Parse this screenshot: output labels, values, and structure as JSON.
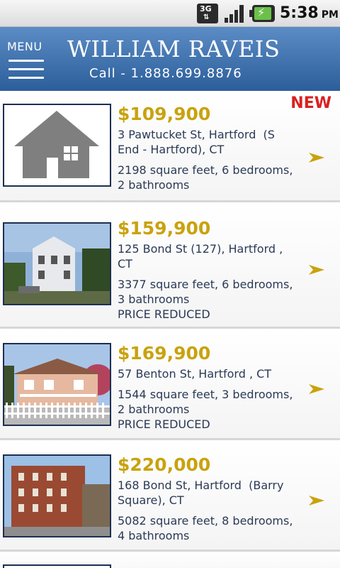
{
  "status_bar": {
    "network": "3G",
    "time": "5:38",
    "ampm": "PM"
  },
  "header": {
    "menu_label": "MENU",
    "brand": "WILLIAM RAVEIS",
    "phone": "Call - 1.888.699.8876"
  },
  "colors": {
    "header_blue": "#3a6ea8",
    "price_gold": "#c9a20e",
    "new_red": "#d92121",
    "arrow_gold": "#c9a20e"
  },
  "listings": [
    {
      "price": "$109,900",
      "address": "3 Pawtucket St, Hartford  (S End - Hartford), CT",
      "specs": "2198 square feet, 6 bedrooms, 2 bathrooms",
      "flag": "",
      "badge": "NEW",
      "image": "house-placeholder-icon"
    },
    {
      "price": "$159,900",
      "address": "125 Bond St (127), Hartford , CT",
      "specs": "3377 square feet, 6 bedrooms, 3 bathrooms",
      "flag": "PRICE REDUCED",
      "badge": "",
      "image": "listing-photo"
    },
    {
      "price": "$169,900",
      "address": "57 Benton St, Hartford , CT",
      "specs": "1544 square feet, 3 bedrooms, 2 bathrooms",
      "flag": "PRICE REDUCED",
      "badge": "",
      "image": "listing-photo"
    },
    {
      "price": "$220,000",
      "address": "168 Bond St, Hartford  (Barry Square), CT",
      "specs": "5082 square feet, 8 bedrooms, 4 bathrooms",
      "flag": "",
      "badge": "",
      "image": "listing-photo"
    }
  ]
}
